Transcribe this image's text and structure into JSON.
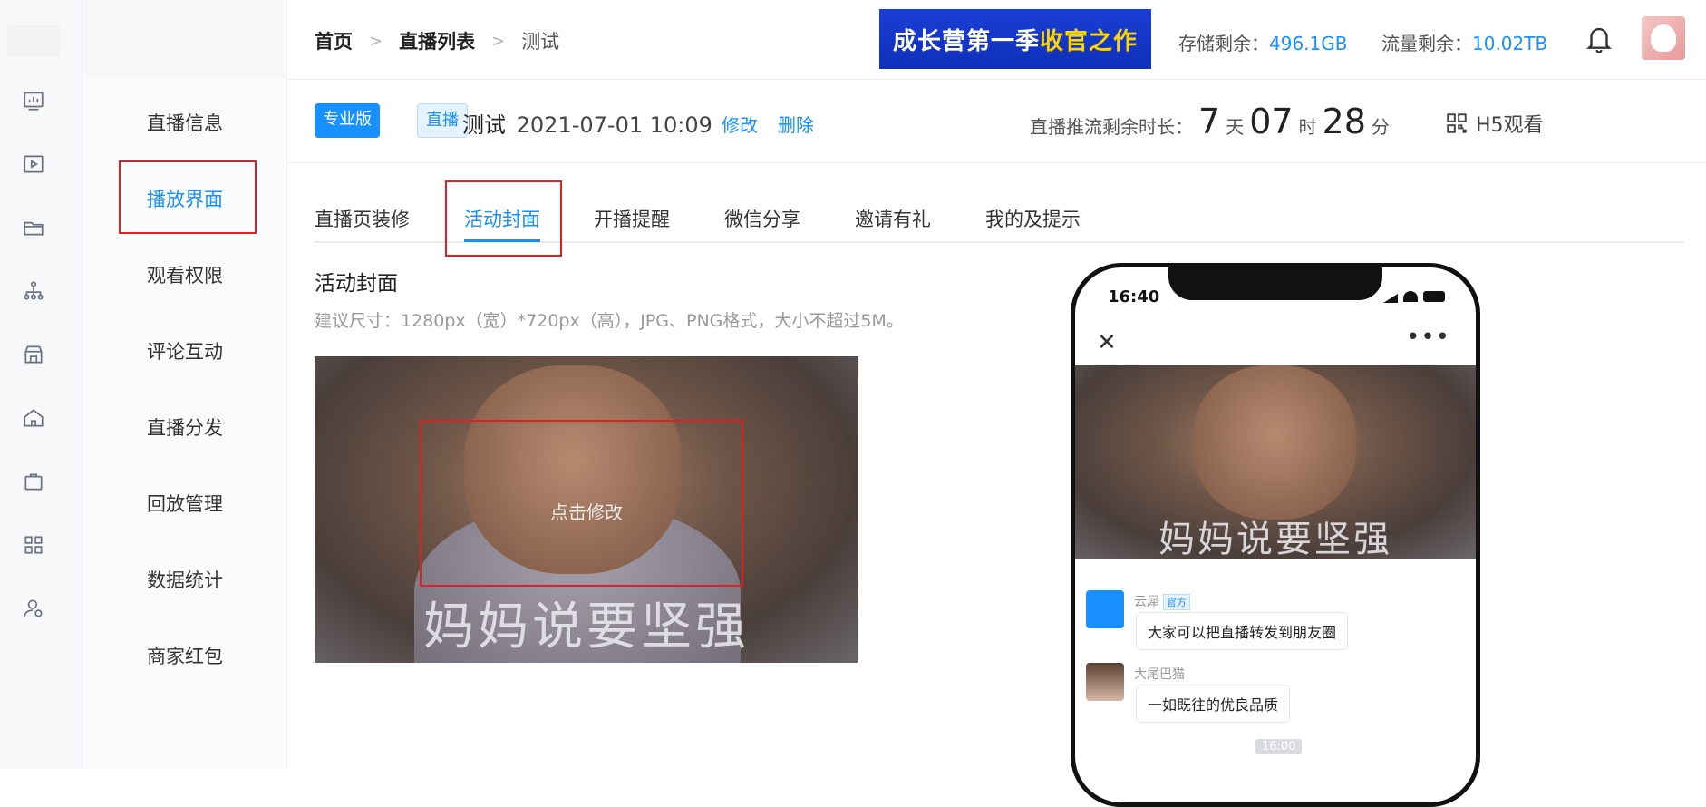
{
  "breadcrumb": {
    "home": "首页",
    "list": "直播列表",
    "current": "测试"
  },
  "banner": {
    "text_a": "成长营第一季",
    "text_b": "收官之作"
  },
  "quota": {
    "storage_label": "存储剩余：",
    "storage_value": "496.1GB",
    "traffic_label": "流量剩余：",
    "traffic_value": "10.02TB"
  },
  "sidebar": {
    "items": [
      {
        "label": "直播信息"
      },
      {
        "label": "播放界面"
      },
      {
        "label": "观看权限"
      },
      {
        "label": "评论互动"
      },
      {
        "label": "直播分发"
      },
      {
        "label": "回放管理"
      },
      {
        "label": "数据统计"
      },
      {
        "label": "商家红包"
      }
    ]
  },
  "rail_icons": [
    "chart-icon",
    "play-icon",
    "folder-icon",
    "org-icon",
    "store-icon",
    "home-icon",
    "bag-icon",
    "grid-icon",
    "user-settings-icon"
  ],
  "live": {
    "tag_pro": "专业版",
    "tag_live": "直播",
    "name": "测试",
    "datetime": "2021-07-01 10:09",
    "edit": "修改",
    "delete": "删除",
    "remain_label": "直播推流剩余时长：",
    "days": "7",
    "days_unit": "天",
    "hours": "07",
    "hours_unit": "时",
    "mins": "28",
    "mins_unit": "分",
    "h5": "H5观看"
  },
  "tabs": [
    {
      "label": "直播页装修"
    },
    {
      "label": "活动封面"
    },
    {
      "label": "开播提醒"
    },
    {
      "label": "微信分享"
    },
    {
      "label": "邀请有礼"
    },
    {
      "label": "我的及提示"
    }
  ],
  "cover": {
    "title": "活动封面",
    "hint": "建议尺寸：1280px（宽）*720px（高），JPG、PNG格式，大小不超过5M。",
    "caption": "妈妈说要坚强",
    "edit_label": "点击修改"
  },
  "phone": {
    "time": "16:40",
    "caption": "妈妈说要坚强",
    "messages": [
      {
        "name": "云犀",
        "badge": "官方",
        "text": "大家可以把直播转发到朋友圈"
      },
      {
        "name": "大尾巴猫",
        "text": "一如既往的优良品质"
      }
    ],
    "timestamp": "16:00"
  },
  "colors": {
    "accent": "#1890ff",
    "highlight_box": "#e02020"
  }
}
